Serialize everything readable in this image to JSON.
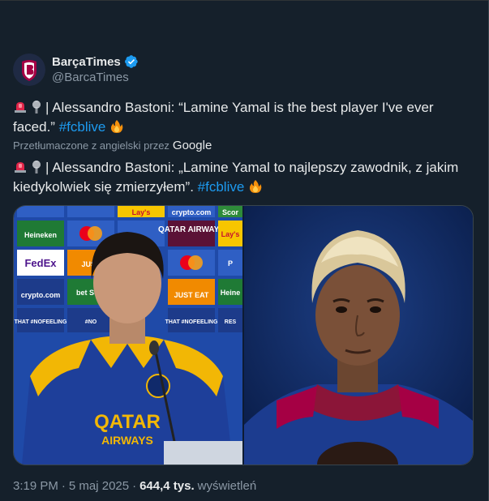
{
  "author": {
    "display_name": "BarçaTimes",
    "handle": "@BarcaTimes",
    "verified": true,
    "avatar_icon": "barcatimes-logo"
  },
  "tweet": {
    "line1_text": "| Alessandro Bastoni: “Lamine Yamal is the best player I've ever faced.”",
    "line1_hashtag": "#fcblive",
    "translated_label": "Przetłumaczone z angielski przez",
    "translated_provider": "Google",
    "line2_text": "| Alessandro Bastoni: „Lamine Yamal to najlepszy zawodnik, z jakim kiedykolwiek się zmierzyłem”.",
    "line2_hashtag": "#fcblive",
    "emojis": [
      "rotating-light",
      "microphone",
      "fire"
    ]
  },
  "media": {
    "left_board": {
      "row1": [
        "",
        "",
        "Lay's",
        "crypto.com",
        "Scor"
      ],
      "row2": [
        "Heineken",
        "",
        "",
        "QATAR AIRWAYS",
        "Lay's"
      ],
      "row3": [
        "FedEx",
        "JUST",
        "",
        "",
        "P"
      ],
      "row4": [
        "crypto.com",
        "bet Scor",
        "",
        "JUST EAT",
        "Heine"
      ],
      "row5": [
        "THAT #NOFEELING",
        "#NO",
        "",
        "THAT #NOFEELING",
        "RES"
      ],
      "shirt_text_1": "QATAR",
      "shirt_text_2": "AIRWAYS"
    }
  },
  "footer": {
    "time": "3:19 PM",
    "dot1": "·",
    "date": "5 maj 2025",
    "dot2": "·",
    "views_count": "644,4 tys.",
    "views_label": "wyświetleń"
  },
  "colors": {
    "background": "#15202b",
    "text": "#e7e9ea",
    "muted": "#8b98a5",
    "link": "#1d9bf0",
    "verified": "#1d9bf0"
  }
}
